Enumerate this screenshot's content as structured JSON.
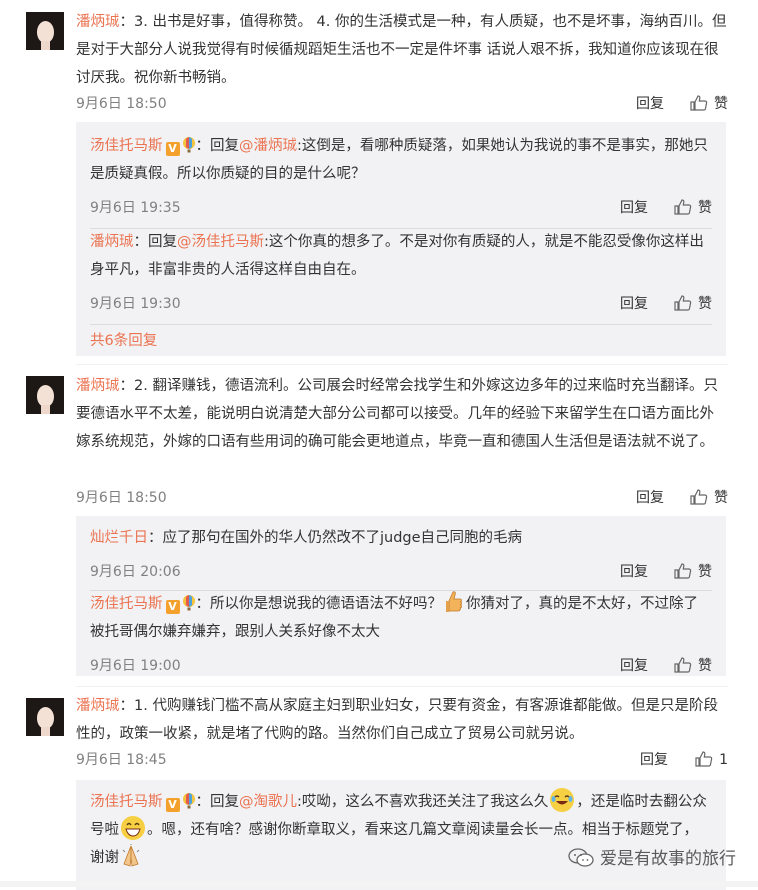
{
  "labels": {
    "reply": "回复",
    "like": "赞"
  },
  "comments": [
    {
      "name": "潘炳珹",
      "colon": "：",
      "text": "3. 出书是好事，值得称赞。 4. 你的生活模式是一种，有人质疑，也不是坏事，海纳百川。但是对于大部分人说我觉得有时候循规蹈矩生活也不一定是件坏事 话说人艰不拆，我知道你应该现在很讨厌我。祝你新书畅销。",
      "time": "9月6日 18:50",
      "replies": [
        {
          "name": "汤佳托马斯",
          "badges": [
            "V",
            "balloon"
          ],
          "prefix": "：回复",
          "mention": "@潘炳珹",
          "text": ":这倒是，看哪种质疑落，如果她认为我说的事不是事实，那她只是质疑真假。所以你质疑的目的是什么呢？",
          "time": "9月6日 19:35"
        },
        {
          "name": "潘炳珹",
          "prefix": "：回复",
          "mention": "@汤佳托马斯",
          "text": ":这个你真的想多了。不是对你有质疑的人，就是不能忍受像你这样出身平凡，非富非贵的人活得这样自由自在。",
          "time": "9月6日 19:30"
        }
      ],
      "more": "共6条回复"
    },
    {
      "name": "潘炳珹",
      "colon": "：",
      "text": "2. 翻译赚钱，德语流利。公司展会时经常会找学生和外嫁这边多年的过来临时充当翻译。只要德语水平不太差，能说明白说清楚大部分公司都可以接受。几年的经验下来留学生在口语方面比外嫁系统规范，外嫁的口语有些用词的确可能会更地道点，毕竟一直和德国人生活但是语法就不说了。",
      "time": "9月6日 18:50",
      "replies": [
        {
          "name": "灿烂千日",
          "prefix": "：应了那句在国外的华人仍然改不了judge自己同胞的毛病",
          "time": "9月6日 20:06"
        },
        {
          "name": "汤佳托马斯",
          "badges": [
            "V",
            "balloon"
          ],
          "prefix": "：所以你是想说我的德语语法不好吗？",
          "emoji": "thumbs-up",
          "text": "你猜对了，真的是不太好，不过除了被托哥偶尔嫌弃嫌弃，跟别人关系好像不太大",
          "time": "9月6日 19:00"
        }
      ]
    },
    {
      "name": "潘炳珹",
      "colon": "：",
      "text": "1. 代购赚钱门槛不高从家庭主妇到职业妇女，只要有资金，有客源谁都能做。但是只是阶段性的，政策一收紧，就是堵了代购的路。当然你们自己成立了贸易公司就另说。",
      "time": "9月6日 18:45",
      "like_count": "1",
      "replies": [
        {
          "name": "汤佳托马斯",
          "badges": [
            "V",
            "balloon"
          ],
          "prefix": "：回复",
          "mention": "@淘歌儿",
          "text_a": ":哎呦，这么不喜欢我还关注了我这么久",
          "text_b": "，还是临时去翻公众号啦",
          "text_c": "。嗯，还有啥？感谢你断章取义，看来这几篇文章阅读量会长一点。相当于标题党了，谢谢"
        }
      ]
    }
  ],
  "watermark": "爱是有故事的旅行",
  "colors": {
    "name": "#eb7350",
    "text": "#333333",
    "meta": "#808080",
    "reply_bg": "#f2f2f5"
  }
}
